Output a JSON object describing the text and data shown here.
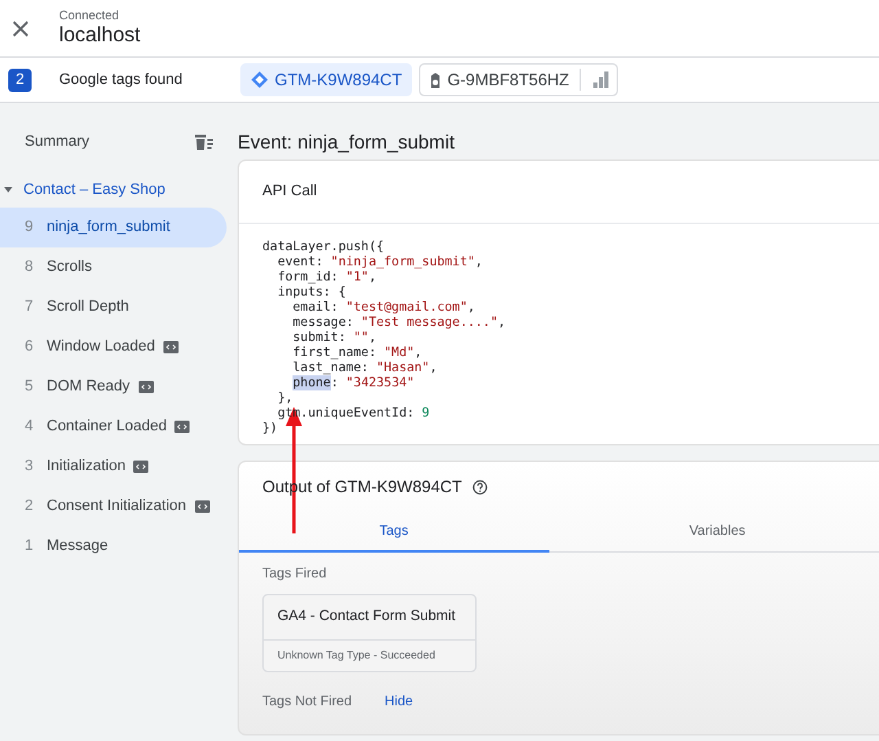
{
  "header": {
    "status": "Connected",
    "host": "localhost"
  },
  "tags_bar": {
    "count": "2",
    "label": "Google tags found",
    "tags": [
      {
        "kind": "gtm",
        "label": "GTM-K9W894CT",
        "selected": true
      },
      {
        "kind": "ga",
        "label": "G-9MBF8T56HZ",
        "selected": false
      }
    ]
  },
  "sidebar": {
    "summary": "Summary",
    "group": {
      "label": "Contact – Easy Shop",
      "expanded": true,
      "items": [
        {
          "number": "9",
          "label": "ninja_form_submit",
          "selected": true,
          "badge": false
        },
        {
          "number": "8",
          "label": "Scrolls",
          "selected": false,
          "badge": false
        },
        {
          "number": "7",
          "label": "Scroll Depth",
          "selected": false,
          "badge": false
        },
        {
          "number": "6",
          "label": "Window Loaded",
          "selected": false,
          "badge": true
        },
        {
          "number": "5",
          "label": "DOM Ready",
          "selected": false,
          "badge": true
        },
        {
          "number": "4",
          "label": "Container Loaded",
          "selected": false,
          "badge": true
        },
        {
          "number": "3",
          "label": "Initialization",
          "selected": false,
          "badge": true
        },
        {
          "number": "2",
          "label": "Consent Initialization",
          "selected": false,
          "badge": true
        },
        {
          "number": "1",
          "label": "Message",
          "selected": false,
          "badge": false
        }
      ]
    }
  },
  "event_title": "Event: ninja_form_submit",
  "api_call": {
    "title": "API Call",
    "code_lines": [
      [
        {
          "text": "dataLayer.push({"
        }
      ],
      [
        {
          "text": "  event: "
        },
        {
          "text": "\"ninja_form_submit\"",
          "kind": "string"
        },
        {
          "text": ","
        }
      ],
      [
        {
          "text": "  form_id: "
        },
        {
          "text": "\"1\"",
          "kind": "string"
        },
        {
          "text": ","
        }
      ],
      [
        {
          "text": "  inputs: {"
        }
      ],
      [
        {
          "text": "    email: "
        },
        {
          "text": "\"test@gmail.com\"",
          "kind": "string"
        },
        {
          "text": ","
        }
      ],
      [
        {
          "text": "    message: "
        },
        {
          "text": "\"Test message....\"",
          "kind": "string"
        },
        {
          "text": ","
        }
      ],
      [
        {
          "text": "    submit: "
        },
        {
          "text": "\"\"",
          "kind": "string"
        },
        {
          "text": ","
        }
      ],
      [
        {
          "text": "    first_name: "
        },
        {
          "text": "\"Md\"",
          "kind": "string"
        },
        {
          "text": ","
        }
      ],
      [
        {
          "text": "    last_name: "
        },
        {
          "text": "\"Hasan\"",
          "kind": "string"
        },
        {
          "text": ","
        }
      ],
      [
        {
          "text": "    phone",
          "kind": "highlight"
        },
        {
          "text": ": "
        },
        {
          "text": "\"3423534\"",
          "kind": "string"
        }
      ],
      [
        {
          "text": "  },"
        }
      ],
      [
        {
          "text": "  gtm.uniqueEventId: "
        },
        {
          "text": "9",
          "kind": "number"
        }
      ],
      [
        {
          "text": "})"
        }
      ]
    ]
  },
  "output": {
    "title": "Output of GTM-K9W894CT",
    "tabs": [
      {
        "label": "Tags",
        "selected": true
      },
      {
        "label": "Variables",
        "selected": false
      }
    ],
    "fired_heading": "Tags Fired",
    "fired": [
      {
        "name": "GA4 - Contact Form Submit",
        "status": "Unknown Tag Type - Succeeded"
      }
    ],
    "not_fired_heading": "Tags Not Fired",
    "hide_link": "Hide"
  }
}
